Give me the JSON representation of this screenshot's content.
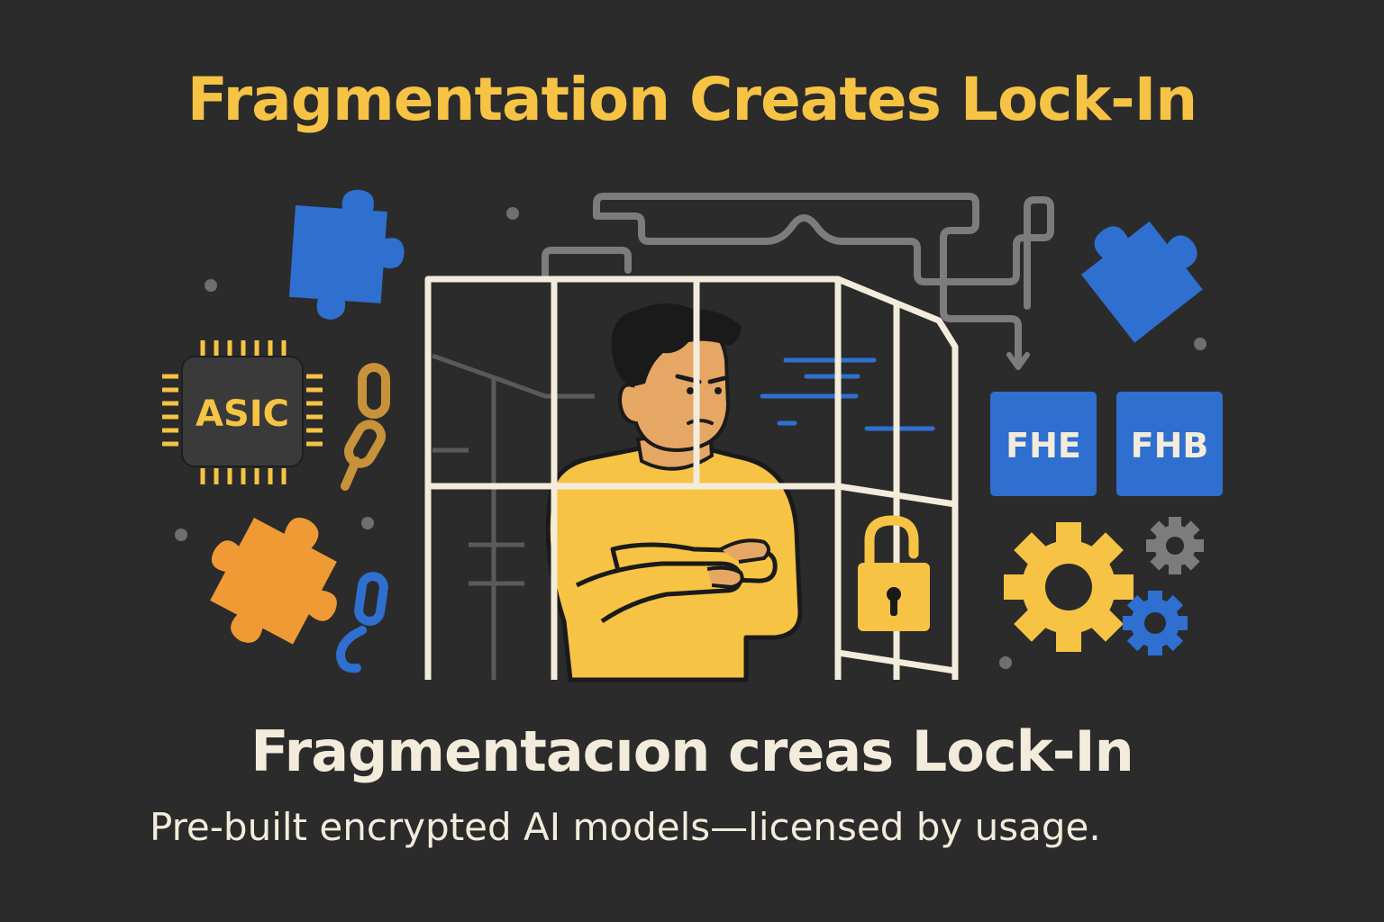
{
  "title": "Fragmentation Creates Lock-In",
  "subtitle": "Fragmentacıon creas Lock-In",
  "caption": "Pre-built encrypted AI models—licensed by usage.",
  "badges": {
    "chip": "ASIC",
    "fhe": "FHE",
    "fhb": "FHB"
  },
  "colors": {
    "background": "#2b2b2b",
    "title": "#f6c344",
    "text": "#f3ecdc",
    "blue": "#2f6fd0",
    "orange": "#f09a36",
    "yellow": "#f6c344",
    "chip_body": "#3a3a3a",
    "cage": "#f3ecdc"
  },
  "icons": [
    "puzzle-piece-icon",
    "chip-icon",
    "chain-link-icon",
    "padlock-icon",
    "gear-icon",
    "person-arms-crossed",
    "cage"
  ]
}
